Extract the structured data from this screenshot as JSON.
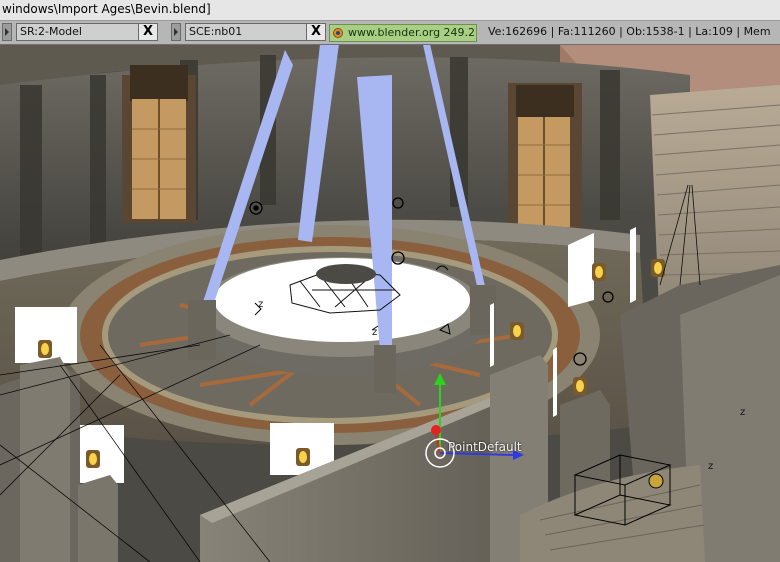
{
  "window": {
    "title": "windows\\Import Ages\\Bevin.blend]"
  },
  "header": {
    "screen": {
      "label": "SR:2-Model",
      "close": "X"
    },
    "scene": {
      "label": "SCE:nb01",
      "close": "X"
    },
    "url": "www.blender.org 249.2",
    "stats": "Ve:162696 | Fa:111260 | Ob:1538-1 | La:109 | Mem"
  },
  "viewport": {
    "object_label": "PointDefault",
    "axis_letters": [
      "z",
      "z",
      "z",
      "z"
    ]
  },
  "colors": {
    "header_bg": "#b6b6b6",
    "url_green": "#a9cf84",
    "light_beam": "#a8b6f2",
    "gizmo_y": "#2bd21e",
    "gizmo_x": "#2f3be0",
    "gizmo_z": "#e42222"
  }
}
